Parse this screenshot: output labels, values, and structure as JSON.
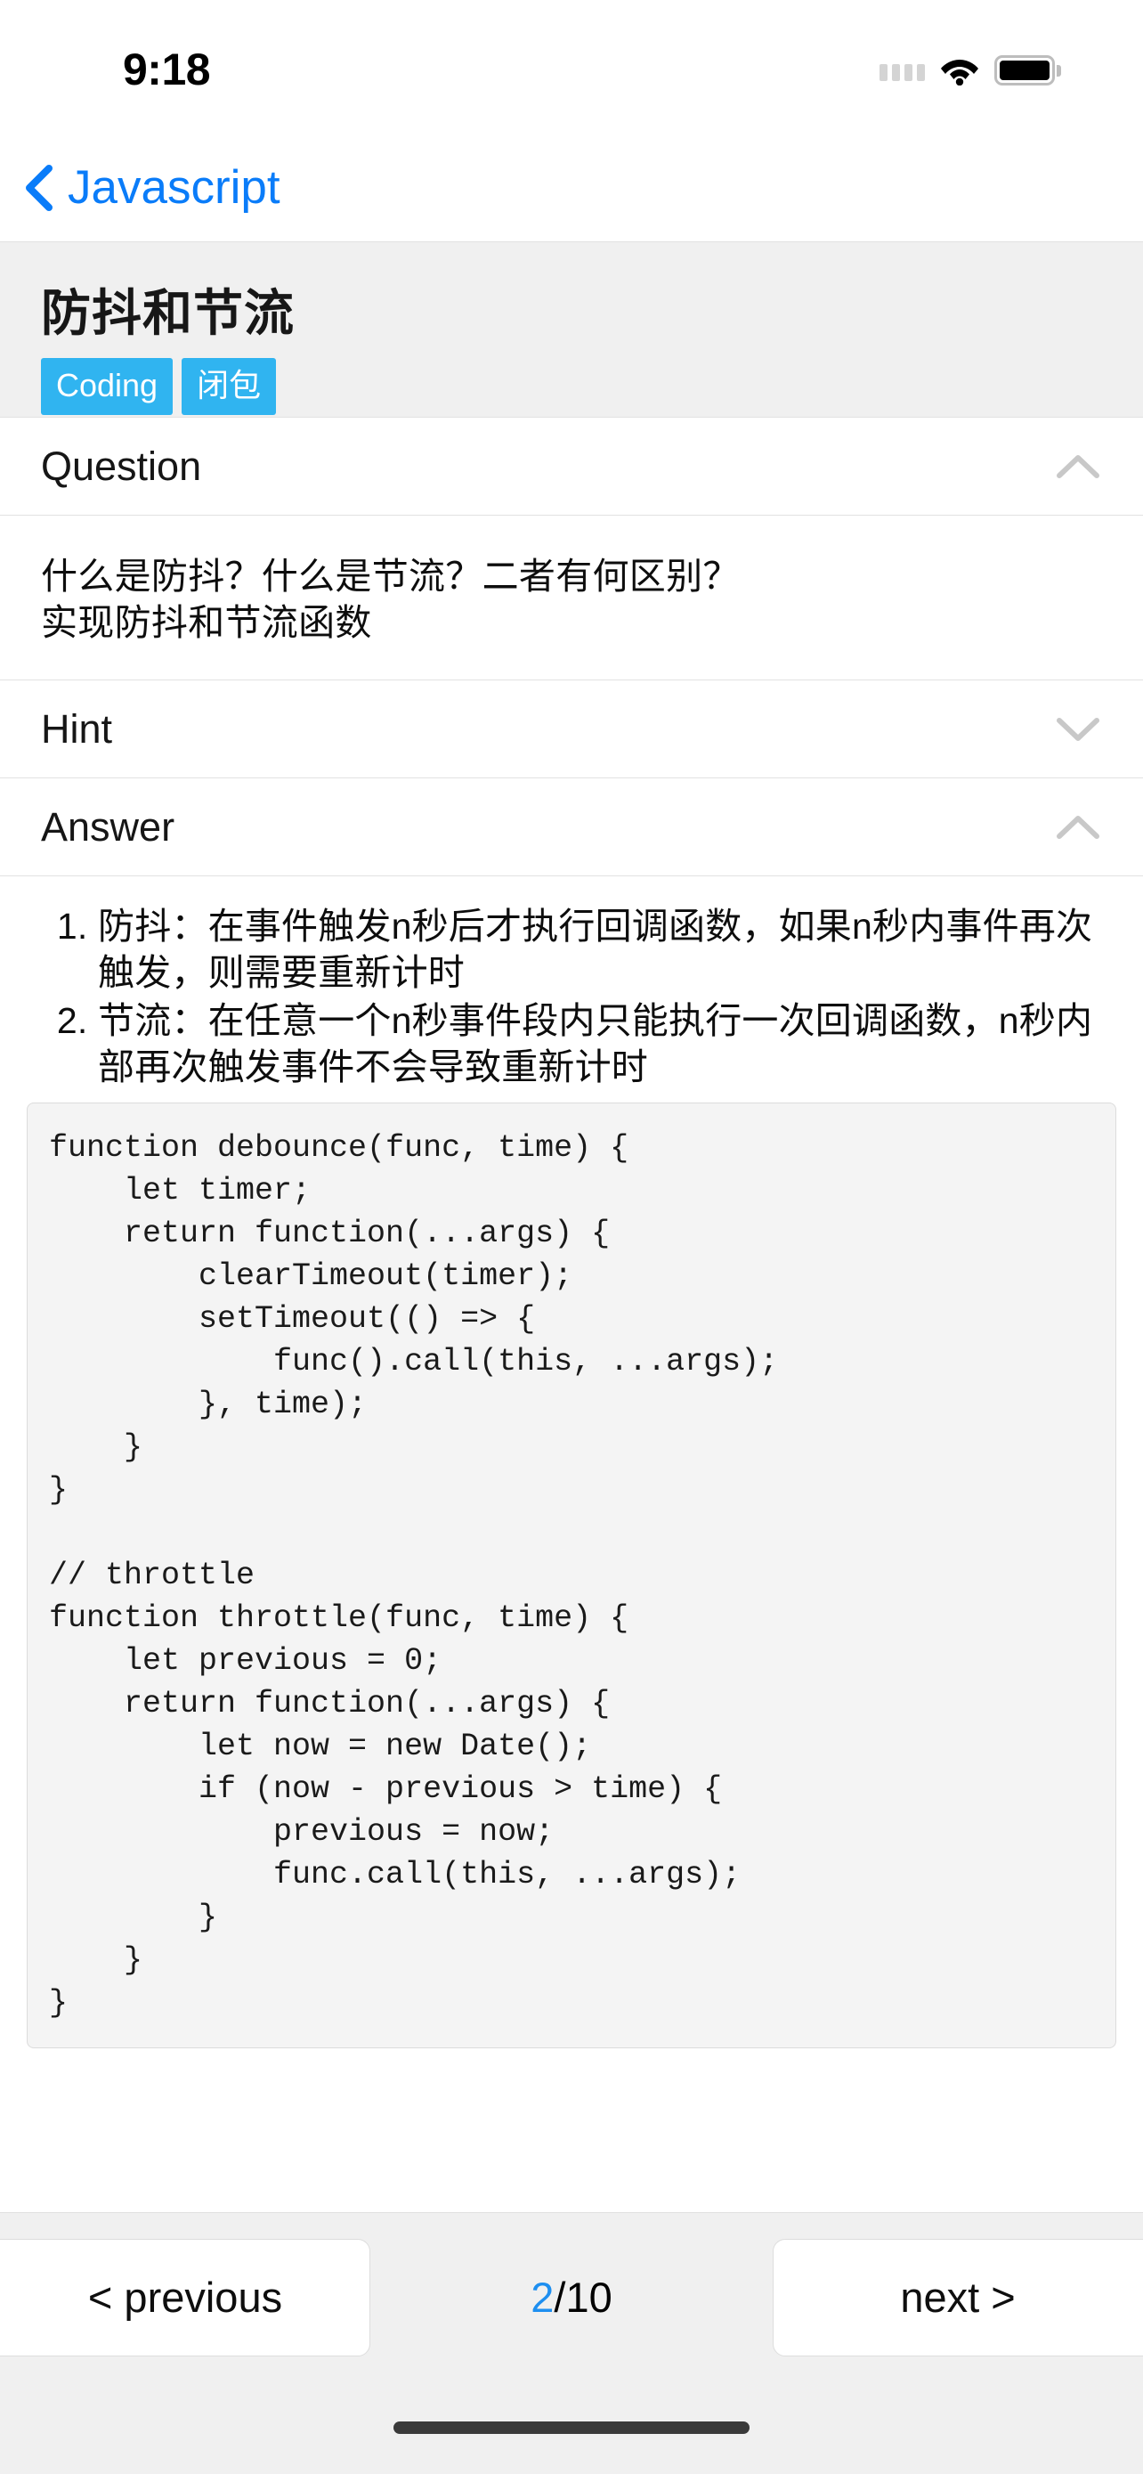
{
  "status_bar": {
    "time": "9:18",
    "icons": [
      "signal-dots-icon",
      "wifi-icon",
      "battery-icon"
    ]
  },
  "navbar": {
    "back_icon": "chevron-left-icon",
    "back_label": "Javascript"
  },
  "header": {
    "title": "防抖和节流",
    "tags": [
      "Coding",
      "闭包"
    ],
    "tag_color": "#30b4f0",
    "background": "#f0f0f0"
  },
  "sections": [
    {
      "label": "Question",
      "expanded": true,
      "toggle_icon": "chevron-up-icon",
      "lines": [
        "什么是防抖？什么是节流？二者有何区别？",
        "实现防抖和节流函数"
      ]
    },
    {
      "label": "Hint",
      "expanded": false,
      "toggle_icon": "chevron-down-icon"
    },
    {
      "label": "Answer",
      "expanded": true,
      "toggle_icon": "chevron-up-icon"
    }
  ],
  "answer": {
    "items": [
      "防抖：在事件触发n秒后才执行回调函数，如果n秒内事件再次触发，则需要重新计时",
      "节流：在任意一个n秒事件段内只能执行一次回调函数，n秒内部再次触发事件不会导致重新计时"
    ],
    "code": "function debounce(func, time) {\n    let timer;\n    return function(...args) {\n        clearTimeout(timer);\n        setTimeout(() => {\n            func().call(this, ...args);\n        }, time);\n    }\n}\n\n// throttle\nfunction throttle(func, time) {\n    let previous = 0;\n    return function(...args) {\n        let now = new Date();\n        if (now - previous > time) {\n            previous = now;\n            func.call(this, ...args);\n        }\n    }\n}"
  },
  "pager": {
    "previous_label": "< previous",
    "next_label": "next >",
    "current_page": "2",
    "page_separator": "/10",
    "current_page_color": "#1e8ff0"
  }
}
